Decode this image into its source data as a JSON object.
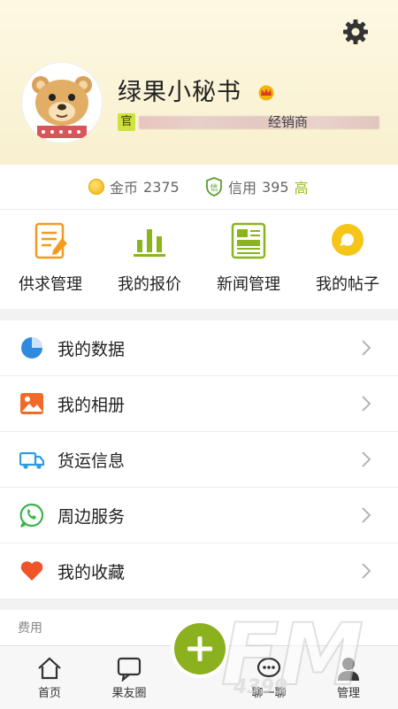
{
  "profile": {
    "name": "绿果小秘书",
    "badge": "官",
    "role": "经销商"
  },
  "stats": {
    "coins_label": "金币",
    "coins_value": "2375",
    "credit_label": "信用",
    "credit_value": "395",
    "credit_level": "高",
    "credit_icon_text": "信"
  },
  "quick_actions": [
    {
      "label": "供求管理",
      "icon": "supply-doc-icon"
    },
    {
      "label": "我的报价",
      "icon": "bar-chart-icon"
    },
    {
      "label": "新闻管理",
      "icon": "news-icon"
    },
    {
      "label": "我的帖子",
      "icon": "chat-bubble-icon"
    }
  ],
  "menu": [
    {
      "label": "我的数据",
      "icon": "pie-chart-icon"
    },
    {
      "label": "我的相册",
      "icon": "photo-icon"
    },
    {
      "label": "货运信息",
      "icon": "truck-icon"
    },
    {
      "label": "周边服务",
      "icon": "phone-bubble-icon"
    },
    {
      "label": "我的收藏",
      "icon": "heart-icon"
    }
  ],
  "section": {
    "title": "费用"
  },
  "bottom_nav": [
    {
      "label": "首页",
      "icon": "home-icon"
    },
    {
      "label": "果友圈",
      "icon": "chat-square-icon"
    },
    {
      "label": "聊一聊",
      "icon": "chat-dots-icon"
    },
    {
      "label": "管理",
      "icon": "person-icon"
    }
  ],
  "watermark": {
    "text": "FM",
    "sub": "4399"
  },
  "colors": {
    "accent": "#8bb11e",
    "header_bg": "#fbf4d8",
    "orange": "#f39a1f",
    "green": "#8ab51c",
    "blue": "#2f8be0"
  }
}
